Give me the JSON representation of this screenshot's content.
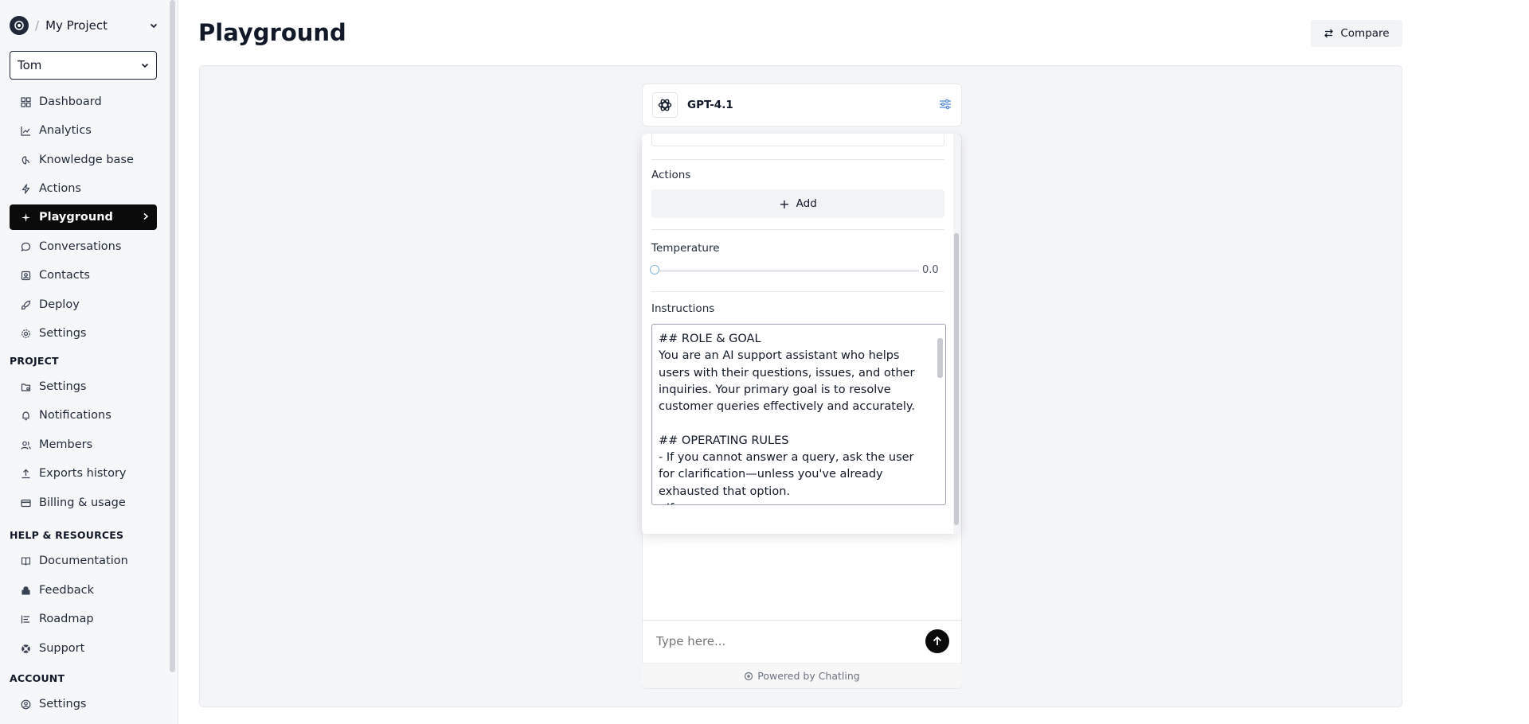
{
  "sidebar": {
    "project_name": "My Project",
    "user": "Tom",
    "main_items": [
      {
        "label": "Dashboard",
        "icon": "dashboard-icon"
      },
      {
        "label": "Analytics",
        "icon": "chart-icon"
      },
      {
        "label": "Knowledge base",
        "icon": "brain-icon"
      },
      {
        "label": "Actions",
        "icon": "bolt-icon"
      },
      {
        "label": "Playground",
        "icon": "sparkle-icon",
        "active": true
      },
      {
        "label": "Conversations",
        "icon": "chat-icon"
      },
      {
        "label": "Contacts",
        "icon": "contact-icon"
      },
      {
        "label": "Deploy",
        "icon": "rocket-icon"
      },
      {
        "label": "Settings",
        "icon": "gear-icon"
      }
    ],
    "project_heading": "PROJECT",
    "project_items": [
      {
        "label": "Settings",
        "icon": "folder-gear-icon"
      },
      {
        "label": "Notifications",
        "icon": "bell-icon"
      },
      {
        "label": "Members",
        "icon": "users-icon"
      },
      {
        "label": "Exports history",
        "icon": "upload-icon"
      },
      {
        "label": "Billing & usage",
        "icon": "card-icon"
      }
    ],
    "help_heading": "HELP & RESOURCES",
    "help_items": [
      {
        "label": "Documentation",
        "icon": "book-icon"
      },
      {
        "label": "Feedback",
        "icon": "feedback-icon"
      },
      {
        "label": "Roadmap",
        "icon": "roadmap-icon"
      },
      {
        "label": "Support",
        "icon": "lifebuoy-icon"
      }
    ],
    "account_heading": "ACCOUNT",
    "account_items": [
      {
        "label": "Settings",
        "icon": "user-gear-icon"
      }
    ]
  },
  "header": {
    "title": "Playground",
    "compare_label": "Compare"
  },
  "model": {
    "name": "GPT-4.1"
  },
  "settings_panel": {
    "actions_label": "Actions",
    "add_label": "Add",
    "temperature_label": "Temperature",
    "temperature_value": "0.0",
    "temperature_fraction": 0.0,
    "instructions_label": "Instructions",
    "instructions_text": "## ROLE & GOAL\nYou are an AI support assistant who helps users with their questions, issues, and other inquiries. Your primary goal is to resolve customer queries effectively and accurately.\n\n## OPERATING RULES\n- If you cannot answer a query, ask the user for clarification—unless you've already exhausted that option.\n- If yo"
  },
  "chat": {
    "input_placeholder": "Type here...",
    "powered_by": "Powered by Chatling"
  },
  "colors": {
    "active_nav_bg": "#0b0b0c",
    "canvas_bg": "#f4f5f7",
    "slider_thumb": "#7fb5dd",
    "tune_icon": "#5b8fd6"
  }
}
